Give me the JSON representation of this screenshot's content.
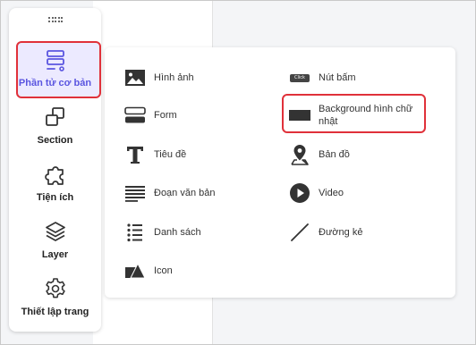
{
  "sidebar": {
    "items": [
      {
        "label": "Phần tử cơ bản",
        "icon": "basic-elements-icon",
        "active": true
      },
      {
        "label": "Section",
        "icon": "section-icon"
      },
      {
        "label": "Tiện ích",
        "icon": "puzzle-icon"
      },
      {
        "label": "Layer",
        "icon": "layers-icon"
      },
      {
        "label": "Thiết lập trang",
        "icon": "gear-icon"
      }
    ]
  },
  "panel": {
    "left": [
      {
        "label": "Hình ảnh",
        "icon": "image-icon"
      },
      {
        "label": "Form",
        "icon": "form-icon"
      },
      {
        "label": "Tiêu đề",
        "icon": "title-icon"
      },
      {
        "label": "Đoạn văn bản",
        "icon": "paragraph-icon"
      },
      {
        "label": "Danh sách",
        "icon": "list-icon"
      },
      {
        "label": "Icon",
        "icon": "shapes-icon"
      }
    ],
    "right": [
      {
        "label": "Nút bấm",
        "icon": "button-icon",
        "badge": "Click"
      },
      {
        "label": "Background hình chữ nhật",
        "icon": "rectangle-icon",
        "highlighted": true
      },
      {
        "label": "Bản đồ",
        "icon": "map-pin-icon"
      },
      {
        "label": "Video",
        "icon": "video-play-icon"
      },
      {
        "label": "Đường kẻ",
        "icon": "line-icon"
      }
    ]
  },
  "colors": {
    "accent": "#5a55e0",
    "highlight": "#e0313a",
    "active_bg": "#eceaff"
  }
}
